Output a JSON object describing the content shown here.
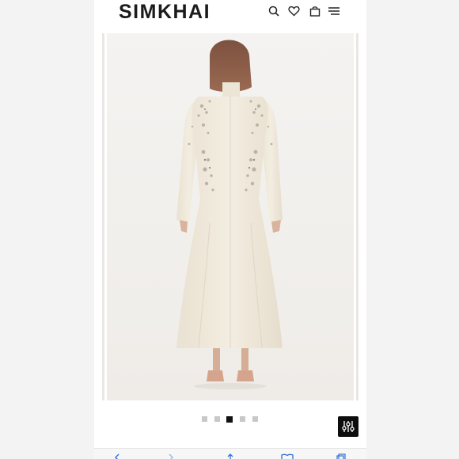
{
  "header": {
    "brand": "SIMKHAI",
    "icons": [
      "search-icon",
      "heart-icon",
      "bag-icon",
      "menu-icon"
    ]
  },
  "gallery": {
    "slide_count": 5,
    "active_slide": 3,
    "image_subject": "product-photo-dress-back"
  },
  "filter_button": {
    "icon": "filter-icon"
  },
  "browser_bar": {
    "icons": [
      "back-icon",
      "forward-icon",
      "share-icon",
      "bookmarks-icon",
      "tabs-icon"
    ]
  },
  "colors": {
    "background": "#f3f2f2",
    "brand_text": "#1b1b1b",
    "dress": "#efe8da",
    "hair": "#8a5b44",
    "active_dot": "#111111",
    "inactive_dot": "#c8c8c8"
  }
}
